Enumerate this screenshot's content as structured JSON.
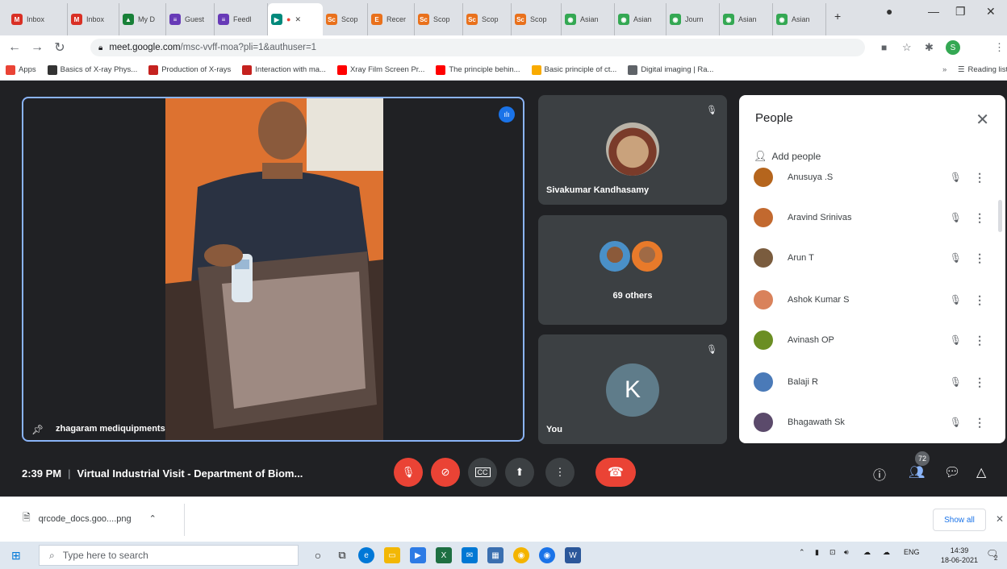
{
  "browser": {
    "tabs": [
      {
        "label": "Inbox",
        "icon": "gmail-icon",
        "color": "#d93025",
        "glyph": "M"
      },
      {
        "label": "Inbox",
        "icon": "gmail-icon",
        "color": "#d93025",
        "glyph": "M"
      },
      {
        "label": "My D",
        "icon": "drive-icon",
        "color": "#188038",
        "glyph": "▲"
      },
      {
        "label": "Guest",
        "icon": "forms-icon",
        "color": "#673ab7",
        "glyph": "≡"
      },
      {
        "label": "Feedl",
        "icon": "forms-icon",
        "color": "#673ab7",
        "glyph": "≡"
      },
      {
        "label": "",
        "icon": "meet-icon",
        "color": "#00897b",
        "glyph": "▶"
      },
      {
        "label": "Scop",
        "icon": "scopus-icon",
        "color": "#e9711c",
        "glyph": "Sc"
      },
      {
        "label": "Recer",
        "icon": "elsevier-icon",
        "color": "#e9711c",
        "glyph": "E"
      },
      {
        "label": "Scop",
        "icon": "scopus-icon",
        "color": "#e9711c",
        "glyph": "Sc"
      },
      {
        "label": "Scop",
        "icon": "scopus-icon",
        "color": "#e9711c",
        "glyph": "Sc"
      },
      {
        "label": "Scop",
        "icon": "scopus-icon",
        "color": "#e9711c",
        "glyph": "Sc"
      },
      {
        "label": "Asian",
        "icon": "globe-icon",
        "color": "#34a853",
        "glyph": "◉"
      },
      {
        "label": "Asian",
        "icon": "globe-icon",
        "color": "#34a853",
        "glyph": "◉"
      },
      {
        "label": "Journ",
        "icon": "globe-icon",
        "color": "#34a853",
        "glyph": "◉"
      },
      {
        "label": "Asian",
        "icon": "globe-icon",
        "color": "#34a853",
        "glyph": "◉"
      },
      {
        "label": "Asian",
        "icon": "globe-icon",
        "color": "#34a853",
        "glyph": "◉"
      }
    ],
    "new_tab": "+",
    "url_host": "meet.google.com",
    "url_path": "/msc-vvff-moa?pli=1&authuser=1",
    "profile_initial": "S",
    "bookmarks": [
      {
        "label": "Apps",
        "color": "#ea4335"
      },
      {
        "label": "Basics of X-ray Phys...",
        "color": "#333333"
      },
      {
        "label": "Production of X-rays",
        "color": "#c5221f"
      },
      {
        "label": "Interaction with ma...",
        "color": "#c5221f"
      },
      {
        "label": "Xray Film Screen Pr...",
        "color": "#ff0000"
      },
      {
        "label": "The principle behin...",
        "color": "#ff0000"
      },
      {
        "label": "Basic principle of ct...",
        "color": "#f9ab00"
      },
      {
        "label": "Digital imaging | Ra...",
        "color": "#5f6368"
      }
    ],
    "more_bookmarks": "»",
    "reading_list": "Reading list"
  },
  "meet": {
    "main_tile_name": "zhagaram mediquipments",
    "tile1_name": "Sivakumar Kandhasamy",
    "tile2_label": "69 others",
    "tile3_name": "You",
    "tile3_initial": "K",
    "meeting_time": "2:39 PM",
    "meeting_title": "Virtual Industrial Visit - Department of Biom...",
    "participant_count": "72",
    "accent": "#8ab4f8",
    "end_call_color": "#ea4335"
  },
  "people": {
    "title": "People",
    "add_people": "Add people",
    "list": [
      {
        "name": "Anusuya .S",
        "color": "#b5651d"
      },
      {
        "name": "Aravind Srinivas",
        "color": "#c2692f"
      },
      {
        "name": "Arun T",
        "color": "#7a5c3e"
      },
      {
        "name": "Ashok Kumar S",
        "color": "#d9825b"
      },
      {
        "name": "Avinash OP",
        "color": "#6b8e23"
      },
      {
        "name": "Balaji R",
        "color": "#4a7ab8"
      },
      {
        "name": "Bhagawath Sk",
        "color": "#5b4a6b"
      }
    ]
  },
  "downloads": {
    "file_name": "qrcode_docs.goo....png",
    "show_all": "Show all"
  },
  "taskbar": {
    "search_placeholder": "Type here to search",
    "language": "ENG",
    "time": "14:39",
    "date": "18-06-2021",
    "notification_count": "2"
  }
}
